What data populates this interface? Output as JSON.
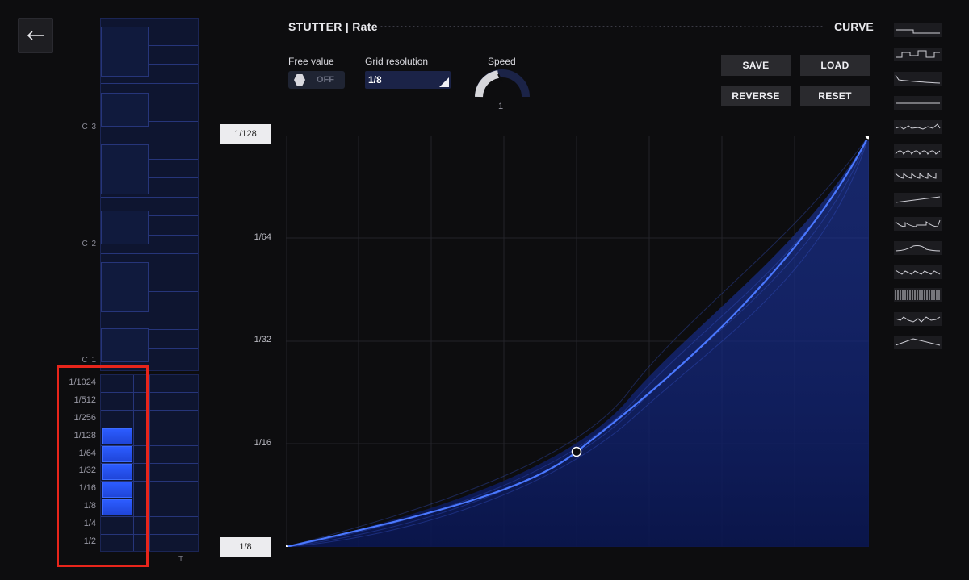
{
  "header": {
    "title": "STUTTER | Rate",
    "mode": "CURVE"
  },
  "controls": {
    "free_value_label": "Free value",
    "free_value_state": "OFF",
    "grid_resolution_label": "Grid resolution",
    "grid_resolution_value": "1/8",
    "speed_label": "Speed",
    "speed_value": "1"
  },
  "buttons": {
    "save": "SAVE",
    "load": "LOAD",
    "reverse": "REVERSE",
    "reset": "RESET"
  },
  "piano": {
    "octave_labels": [
      "C 3",
      "C 2",
      "C 1"
    ]
  },
  "rate_grid": {
    "rows": [
      "1/1024",
      "1/512",
      "1/256",
      "1/128",
      "1/64",
      "1/32",
      "1/16",
      "1/8",
      "1/4",
      "1/2"
    ],
    "active_rows": [
      "1/128",
      "1/64",
      "1/32",
      "1/16",
      "1/8"
    ],
    "column_label": "T"
  },
  "graph": {
    "top_value": "1/128",
    "bottom_value": "1/8",
    "y_labels": [
      "1/64",
      "1/32",
      "1/16"
    ]
  },
  "colors": {
    "accent": "#2c5cff",
    "highlight": "#e8251b",
    "background": "#0d0d0f"
  },
  "icons": {
    "back": "arrow-left-icon"
  },
  "presets": [
    "preset-1",
    "preset-2",
    "preset-3",
    "preset-4",
    "preset-5",
    "preset-6",
    "preset-7",
    "preset-8",
    "preset-9",
    "preset-10",
    "preset-11",
    "preset-12",
    "preset-13",
    "preset-14"
  ]
}
